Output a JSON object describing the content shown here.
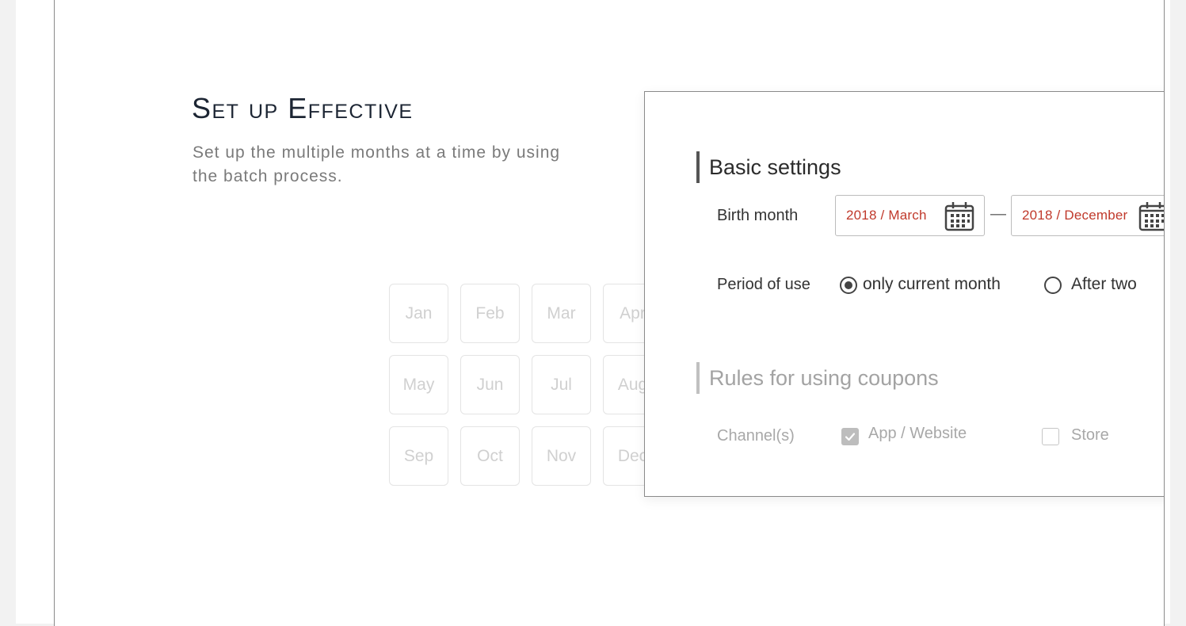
{
  "intro": {
    "title": "Set up Effective",
    "description": "Set up the multiple months at a time by using the batch process."
  },
  "months": [
    "Jan",
    "Feb",
    "Mar",
    "Apr",
    "May",
    "Jun",
    "Jul",
    "Aug",
    "Sep",
    "Oct",
    "Nov",
    "Dec"
  ],
  "panel": {
    "basic_settings": {
      "title": "Basic settings",
      "birth_month": {
        "label": "Birth month",
        "from": "2018 / March",
        "separator": "—",
        "to": "2018 / December"
      },
      "period_of_use": {
        "label": "Period of use",
        "options": [
          {
            "label": "only current month",
            "selected": true
          },
          {
            "label": "After two",
            "selected": false
          }
        ]
      }
    },
    "coupon_rules": {
      "title": "Rules for using coupons",
      "channels": {
        "label": "Channel(s)",
        "options": [
          {
            "label": "App / Website",
            "checked": true
          },
          {
            "label": "Store",
            "checked": false
          }
        ]
      }
    }
  },
  "colors": {
    "date_text": "#c0392b",
    "heading": "#1c2533",
    "disabled": "#a8a8a8"
  }
}
